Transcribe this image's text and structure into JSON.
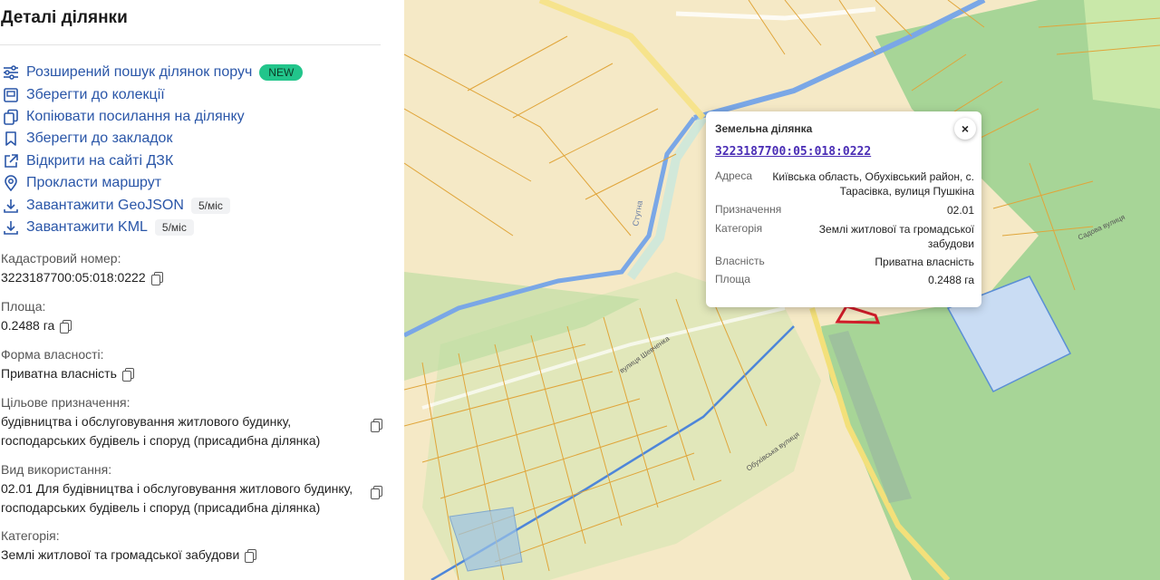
{
  "panel": {
    "title": "Деталі ділянки",
    "actions": [
      {
        "label": "Розширений пошук ділянок поруч",
        "badge": "NEW",
        "icon": "filter-sliders-icon"
      },
      {
        "label": "Зберегти до колекції",
        "icon": "collection-icon"
      },
      {
        "label": "Копіювати посилання на ділянку",
        "icon": "copy-link-icon"
      },
      {
        "label": "Зберегти до закладок",
        "icon": "bookmark-icon"
      },
      {
        "label": "Відкрити на сайті ДЗК",
        "icon": "external-link-icon"
      },
      {
        "label": "Прокласти маршрут",
        "icon": "location-pin-icon"
      },
      {
        "label": "Завантажити GeoJSON",
        "limit": "5/міс",
        "icon": "download-icon"
      },
      {
        "label": "Завантажити KML",
        "limit": "5/міс",
        "icon": "download-icon"
      }
    ],
    "fields": {
      "cadastral": {
        "label": "Кадастровий номер:",
        "value": "3223187700:05:018:0222"
      },
      "area": {
        "label": "Площа:",
        "value": "0.2488 га"
      },
      "ownership": {
        "label": "Форма власності:",
        "value": "Приватна власність"
      },
      "purpose": {
        "label": "Цільове призначення:",
        "line1": "будівництва і обслуговування житлового будинку,",
        "line2": "господарських будівель і споруд (присадибна ділянка)"
      },
      "usage": {
        "label": "Вид використання:",
        "line1": "02.01 Для будівництва і обслуговування житлового будинку,",
        "line2": "господарських будівель і споруд (присадибна ділянка)"
      },
      "category": {
        "label": "Категорія:",
        "value": "Землі житлової та громадської забудови"
      }
    }
  },
  "map": {
    "street_labels": [
      "вулиця Шевченка",
      "Садова вулиця",
      "Обухівська вулиця",
      "Стугна"
    ],
    "colors": {
      "parcel_fill": "#f5e9c6",
      "parcel_line": "#e0a53a",
      "forest": "#9fd28f",
      "river": "#7aa7e6",
      "selected": "#d01d2a"
    }
  },
  "popup": {
    "title": "Земельна ділянка",
    "close": "×",
    "cadastral_link": "3223187700:05:018:0222",
    "rows": [
      {
        "key": "Адреса",
        "value": "Київська область, Обухівський район, с. Тарасівка, вулиця Пушкіна"
      },
      {
        "key": "Призначення",
        "value": "02.01"
      },
      {
        "key": "Категорія",
        "value": "Землі житлової та громадської забудови"
      },
      {
        "key": "Власність",
        "value": "Приватна власність"
      },
      {
        "key": "Площа",
        "value": "0.2488 га"
      }
    ]
  }
}
